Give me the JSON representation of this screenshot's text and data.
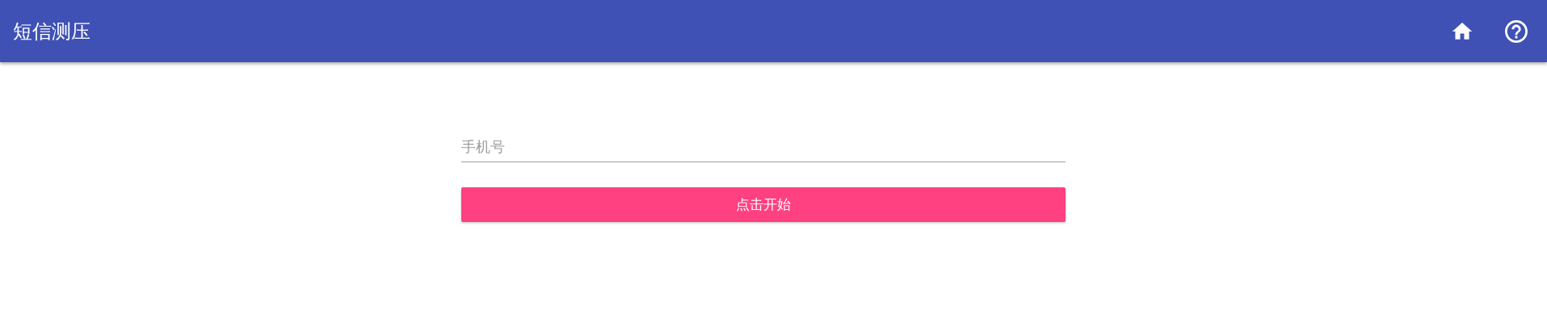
{
  "app_bar": {
    "title": "短信测压"
  },
  "form": {
    "phone": {
      "placeholder": "手机号"
    },
    "submit": "点击开始"
  }
}
